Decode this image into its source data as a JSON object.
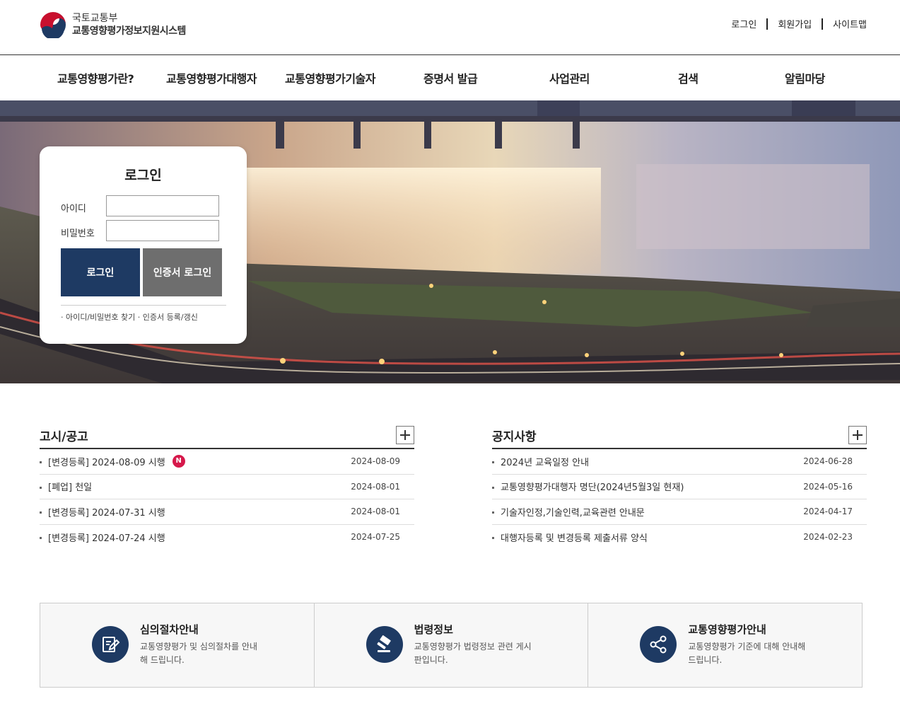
{
  "header": {
    "ministry": "국토교통부",
    "system_name": "교통영향평가정보지원시스템",
    "util_links": [
      "로그인",
      "회원가입",
      "사이트맵"
    ]
  },
  "nav": {
    "items": [
      "교통영향평가란?",
      "교통영향평가대행자",
      "교통영향평가기술자",
      "증명서 발급",
      "사업관리",
      "검색",
      "알림마당"
    ]
  },
  "login": {
    "title": "로그인",
    "id_label": "아이디",
    "id_value": "",
    "pw_label": "비밀번호",
    "pw_value": "",
    "login_button": "로그인",
    "cert_login_button": "인증서 로그인",
    "find_link": "· 아이디/비밀번호 찾기",
    "cert_register_link": "· 인증서 등록/갱신"
  },
  "notices_board": {
    "title": "고시/공고",
    "new_badge": "N",
    "rows": [
      {
        "title": "[변경등록] 2024-08-09 시행",
        "date": "2024-08-09"
      },
      {
        "title": "[폐업] 천일",
        "date": "2024-08-01"
      },
      {
        "title": "[변경등록] 2024-07-31 시행",
        "date": "2024-08-01"
      },
      {
        "title": "[변경등록] 2024-07-24 시행",
        "date": "2024-07-25"
      }
    ]
  },
  "announcements_board": {
    "title": "공지사항",
    "rows": [
      {
        "title": "2024년 교육일정 안내",
        "date": "2024-06-28"
      },
      {
        "title": "교통영향평가대행자 명단(2024년5월3일 현재)",
        "date": "2024-05-16"
      },
      {
        "title": "기술자인정,기술인력,교육관련 안내문",
        "date": "2024-04-17"
      },
      {
        "title": "대행자등록 및 변경등록 제출서류 양식",
        "date": "2024-02-23"
      }
    ]
  },
  "cards": [
    {
      "title": "심의절차안내",
      "desc": "교통영향평가 및 심의절차를 안내해 드립니다.",
      "icon": "document-edit-icon"
    },
    {
      "title": "법령정보",
      "desc": "교통영향평가 법령정보 관련 게시판입니다.",
      "icon": "gavel-icon"
    },
    {
      "title": "교통영향평가안내",
      "desc": "교통영향평가 기준에 대해 안내해 드립니다.",
      "icon": "share-icon"
    }
  ],
  "colors": {
    "primary": "#1e3a63",
    "secondary_button": "#6e6e6e",
    "new_badge": "#d6194b"
  }
}
